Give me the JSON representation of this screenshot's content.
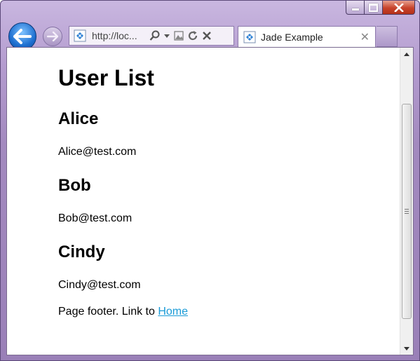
{
  "browser": {
    "address": {
      "url": "http://loc..."
    },
    "tab": {
      "title": "Jade Example",
      "close": "✕"
    }
  },
  "page": {
    "heading": "User List",
    "users": [
      {
        "name": "Alice",
        "email": "Alice@test.com"
      },
      {
        "name": "Bob",
        "email": "Bob@test.com"
      },
      {
        "name": "Cindy",
        "email": "Cindy@test.com"
      }
    ],
    "footer": {
      "text": "Page footer. Link to ",
      "link_label": "Home"
    }
  },
  "colors": {
    "link": "#1a9bd7",
    "accent": "#a38abf"
  }
}
